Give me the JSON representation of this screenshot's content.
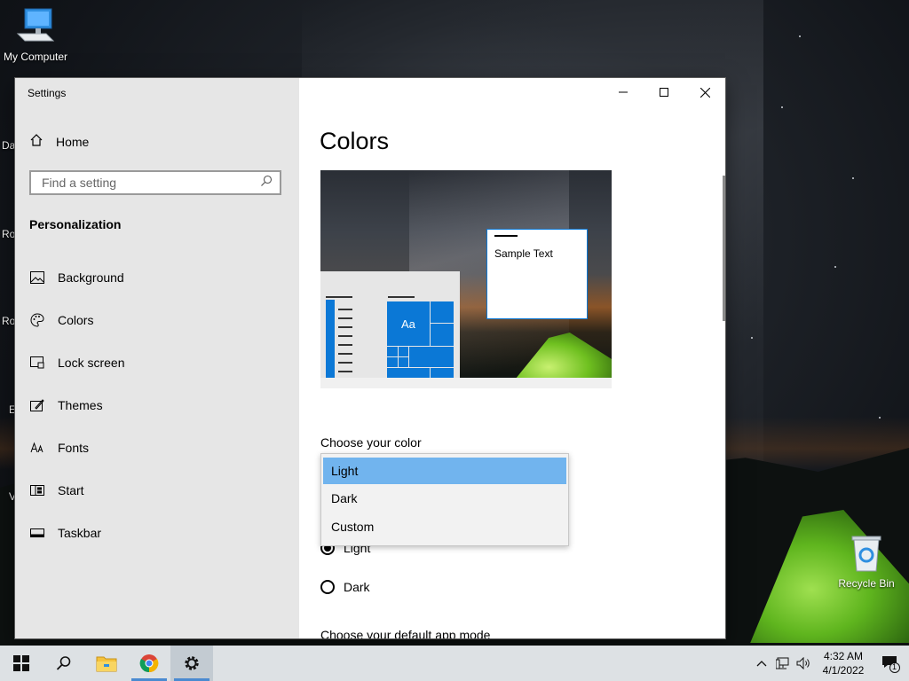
{
  "desktop": {
    "icons": [
      {
        "label": "My Computer"
      },
      {
        "label": "Recycle Bin"
      }
    ],
    "partial_labels": [
      "Da",
      "Ro",
      "Ro",
      "E",
      "V"
    ]
  },
  "window": {
    "title": "Settings",
    "sidebar": {
      "home_label": "Home",
      "search_placeholder": "Find a setting",
      "section_heading": "Personalization",
      "items": [
        {
          "label": "Background",
          "icon": "picture-icon"
        },
        {
          "label": "Colors",
          "icon": "palette-icon"
        },
        {
          "label": "Lock screen",
          "icon": "lock-screen-icon"
        },
        {
          "label": "Themes",
          "icon": "themes-icon"
        },
        {
          "label": "Fonts",
          "icon": "fonts-icon"
        },
        {
          "label": "Start",
          "icon": "start-icon"
        },
        {
          "label": "Taskbar",
          "icon": "taskbar-icon"
        }
      ]
    },
    "content": {
      "page_title": "Colors",
      "preview": {
        "tile_text": "Aa",
        "sample_text": "Sample Text"
      },
      "choose_color_label": "Choose your color",
      "dropdown_options": [
        "Light",
        "Dark",
        "Custom"
      ],
      "dropdown_selected": "Light",
      "radio_options": [
        {
          "label": "Light",
          "checked": true
        },
        {
          "label": "Dark",
          "checked": false
        }
      ],
      "default_app_mode_label": "Choose your default app mode"
    }
  },
  "taskbar": {
    "time": "4:32 AM",
    "date": "4/1/2022",
    "notification_count": "1",
    "accent": "#0b78d6"
  }
}
